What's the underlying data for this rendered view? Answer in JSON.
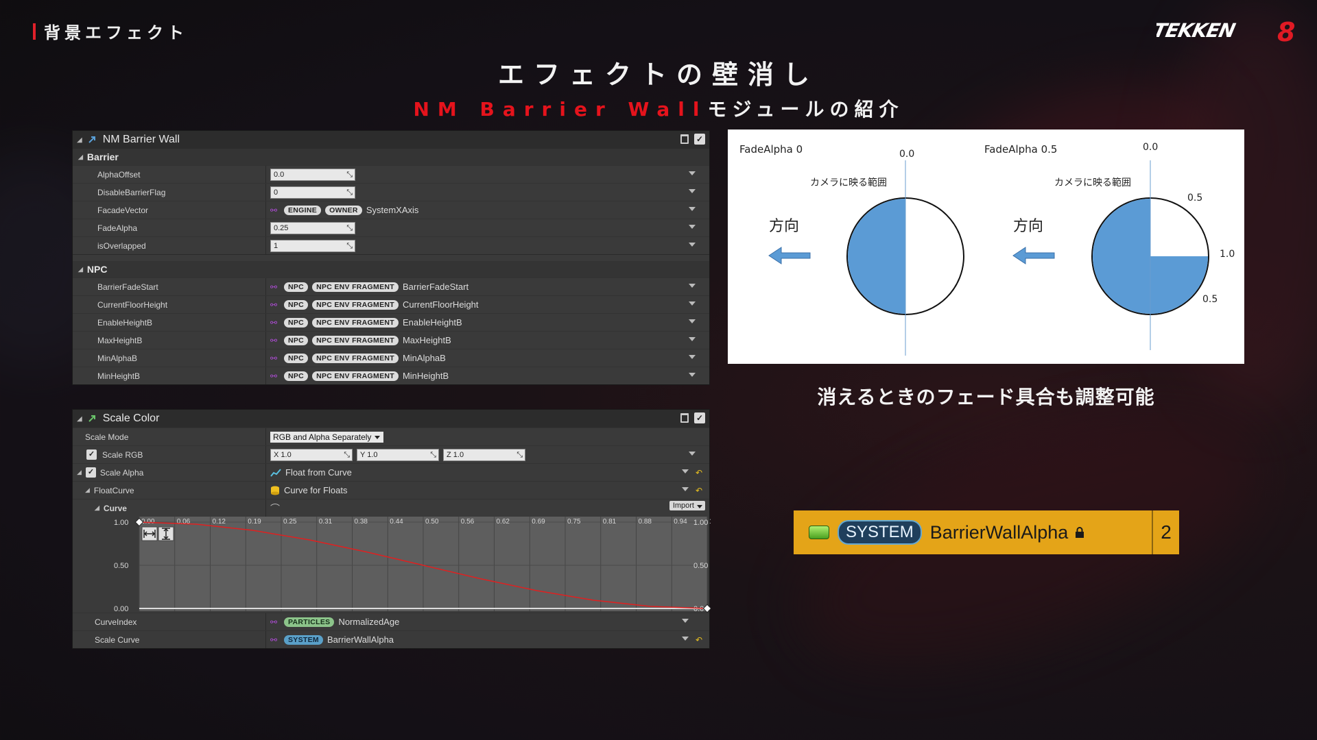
{
  "section_label": "背景エフェクト",
  "logo_text": "TEKKEN",
  "logo_number": "8",
  "title": "エフェクトの壁消し",
  "subtitle_red": "NM Barrier Wall",
  "subtitle_white": "モジュールの紹介",
  "panel1": {
    "title": "NM Barrier Wall",
    "group1": "Barrier",
    "rows1": [
      {
        "label": "AlphaOffset",
        "value": "0.0"
      },
      {
        "label": "DisableBarrierFlag",
        "value": "0"
      },
      {
        "label": "FacadeVector",
        "pill1": "ENGINE",
        "pill2": "OWNER",
        "text": "SystemXAxis"
      },
      {
        "label": "FadeAlpha",
        "value": "0.25"
      },
      {
        "label": "isOverlapped",
        "value": "1"
      }
    ],
    "group2": "NPC",
    "npc_pill1": "NPC",
    "npc_pill2": "NPC ENV FRAGMENT",
    "rows2": [
      {
        "label": "BarrierFadeStart",
        "text": "BarrierFadeStart"
      },
      {
        "label": "CurrentFloorHeight",
        "text": "CurrentFloorHeight"
      },
      {
        "label": "EnableHeightB",
        "text": "EnableHeightB"
      },
      {
        "label": "MaxHeightB",
        "text": "MaxHeightB"
      },
      {
        "label": "MinAlphaB",
        "text": "MinAlphaB"
      },
      {
        "label": "MinHeightB",
        "text": "MinHeightB"
      }
    ]
  },
  "panel2": {
    "title": "Scale Color",
    "scale_mode_label": "Scale Mode",
    "scale_mode_value": "RGB and Alpha Separately",
    "scale_rgb_label": "Scale RGB",
    "x_value": "X 1.0",
    "y_value": "Y 1.0",
    "z_value": "Z 1.0",
    "scale_alpha_label": "Scale Alpha",
    "scale_alpha_value": "Float from Curve",
    "floatcurve_label": "FloatCurve",
    "floatcurve_value": "Curve for Floats",
    "curve_label": "Curve",
    "import_label": "Import",
    "curveindex_label": "CurveIndex",
    "curveindex_pill": "PARTICLES",
    "curveindex_value": "NormalizedAge",
    "scalecurve_label": "Scale Curve",
    "scalecurve_pill": "SYSTEM",
    "scalecurve_value": "BarrierWallAlpha"
  },
  "chart_data": {
    "type": "line",
    "x_ticks": [
      "0.00",
      "0.06",
      "0.12",
      "0.19",
      "0.25",
      "0.31",
      "0.38",
      "0.44",
      "0.50",
      "0.56",
      "0.62",
      "0.69",
      "0.75",
      "0.81",
      "0.88",
      "0.94",
      "1.00"
    ],
    "y_ticks_left": [
      "1.00",
      "0.50",
      "0.00"
    ],
    "y_ticks_right": [
      "1.00",
      "0.50",
      "0.00"
    ],
    "xlim": [
      0,
      1
    ],
    "ylim": [
      0,
      1
    ],
    "x": [
      0,
      0.1,
      0.2,
      0.3,
      0.4,
      0.5,
      0.6,
      0.7,
      0.8,
      0.9,
      1.0
    ],
    "y": [
      1.0,
      0.976,
      0.905,
      0.794,
      0.655,
      0.5,
      0.345,
      0.206,
      0.095,
      0.024,
      0.0
    ],
    "keys": [
      {
        "x": 0,
        "y": 1
      },
      {
        "x": 1,
        "y": 0
      }
    ],
    "line_color": "#e02020"
  },
  "diagram": {
    "left_title": "FadeAlpha 0",
    "right_title": "FadeAlpha 0.5",
    "top_label": "0.0",
    "range_label": "カメラに映る範囲",
    "direction_label": "方向",
    "label_05": "0.5",
    "label_10": "1.0",
    "fill_color": "#5b9bd5",
    "left_filled_fraction": 0.5,
    "right_filled_fraction": 0.75
  },
  "caption": "消えるときのフェード具合も調整可能",
  "sysbar": {
    "pill": "SYSTEM",
    "name": "BarrierWallAlpha",
    "count": "2",
    "color": "#e4a418"
  }
}
